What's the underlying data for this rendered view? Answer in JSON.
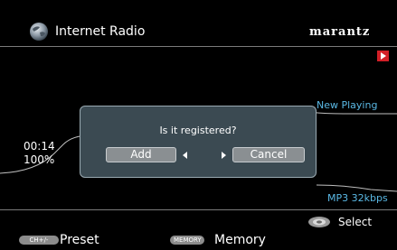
{
  "header": {
    "source_title": "Internet Radio",
    "brand": "marantz",
    "source_icon": "globe-icon",
    "play_indicator_icon": "play-icon"
  },
  "playback": {
    "status_text": "New Playing",
    "time": "00:14",
    "volume": "100%",
    "format": "MP3 32kbps"
  },
  "dialog": {
    "question": "Is it registered?",
    "add_label": "Add",
    "cancel_label": "Cancel"
  },
  "footer": {
    "select_label": "Select",
    "select_icon": "cursor-pad-icon",
    "preset_key": "CH+/-",
    "preset_label": "Preset",
    "memory_key": "MEMORY",
    "memory_label": "Memory"
  },
  "colors": {
    "background": "#000000",
    "accent_text": "#5ab8e4",
    "dialog_bg": "#3b4a52",
    "button_bg": "#8a8f92",
    "play_indicator": "#d21f27"
  }
}
